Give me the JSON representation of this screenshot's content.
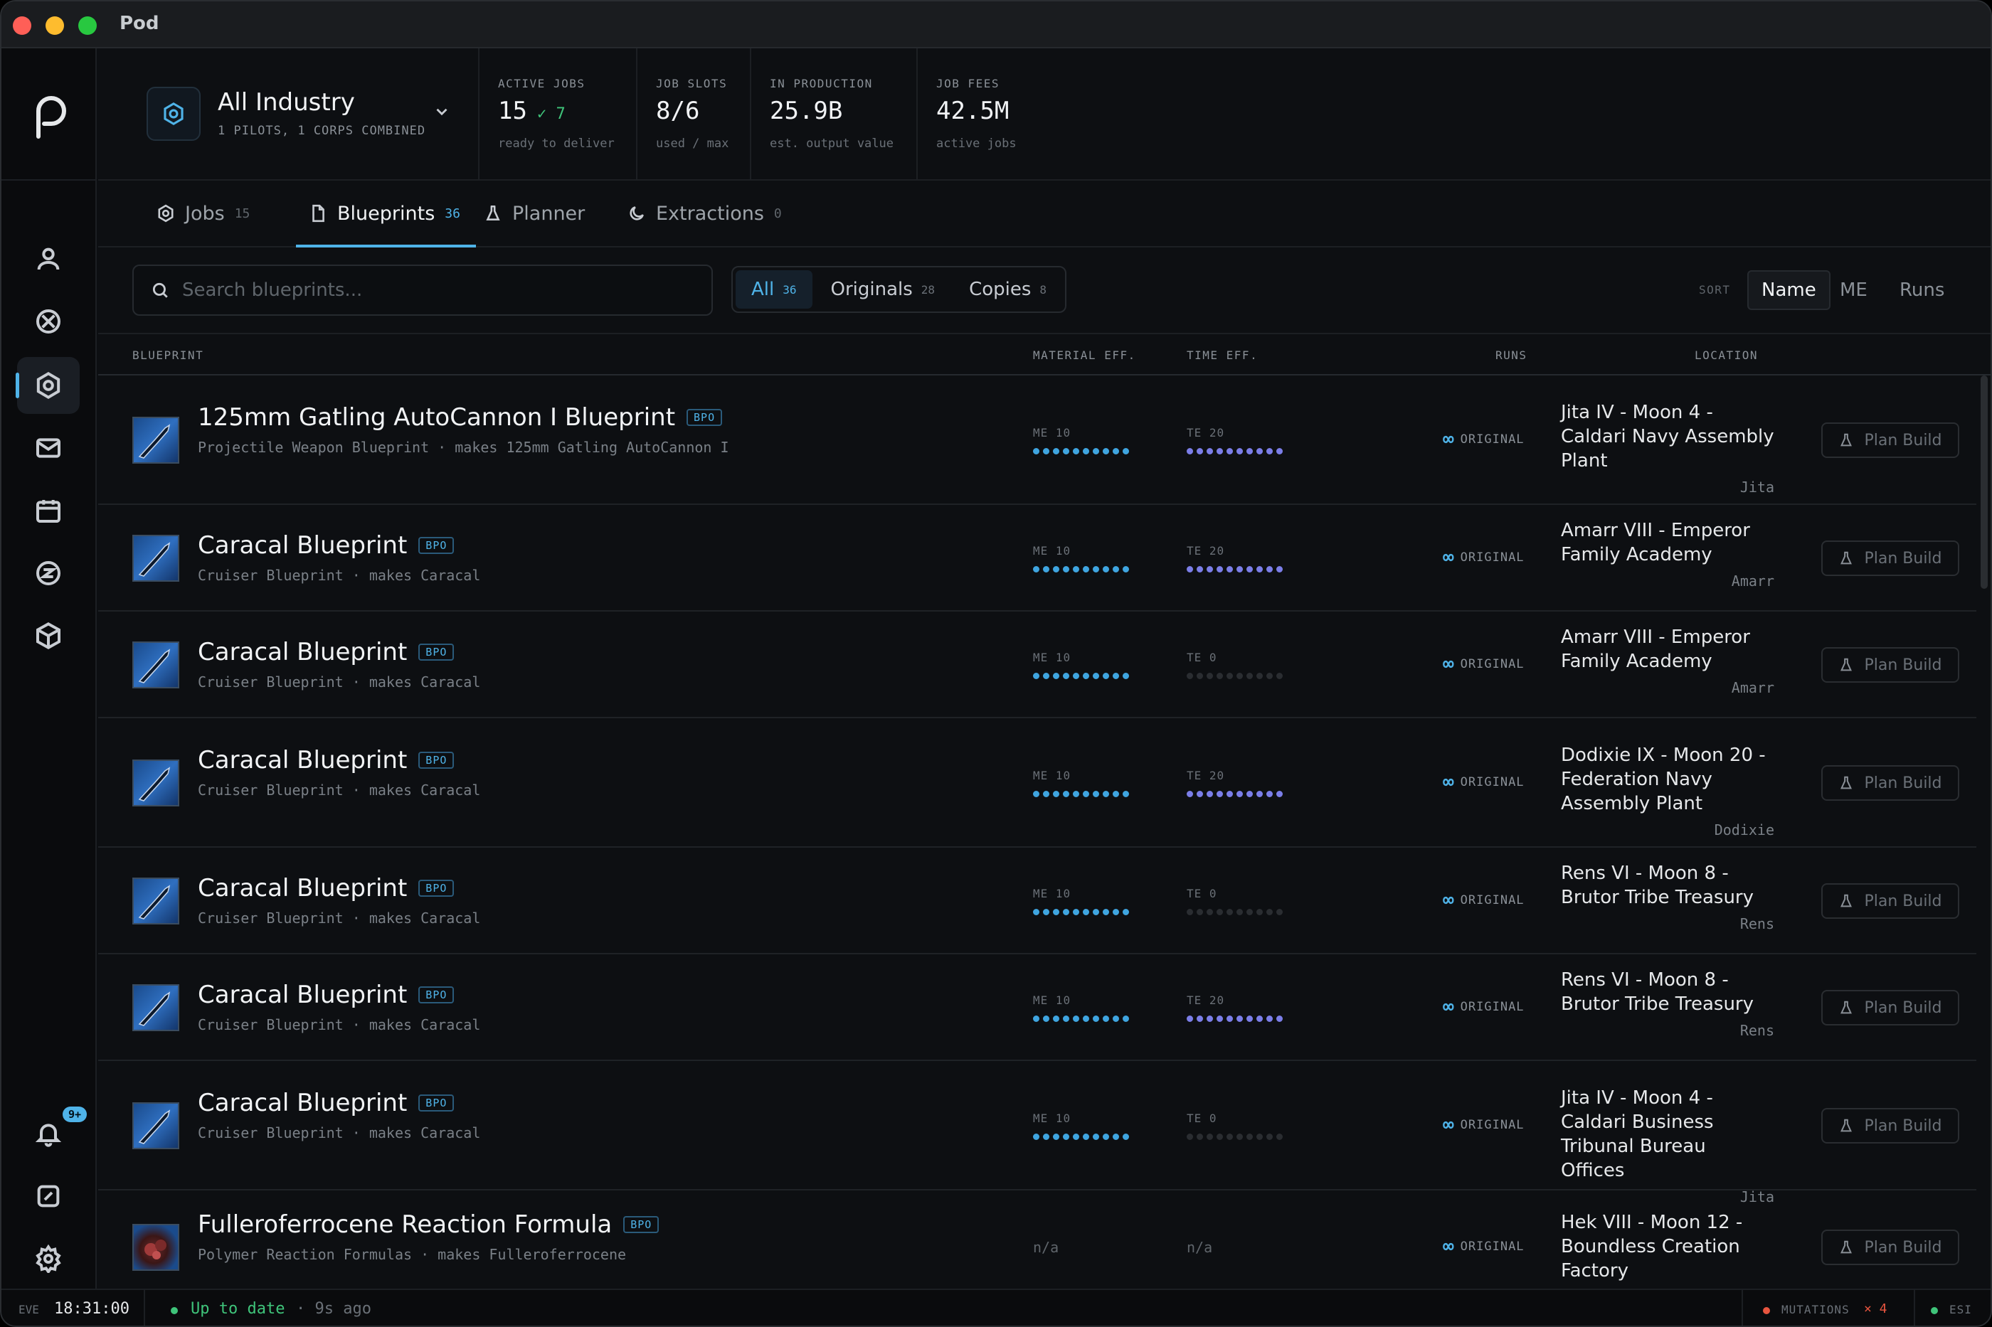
{
  "window": {
    "title": "Pod"
  },
  "header": {
    "title": "All Industry",
    "subtitle": "1 PILOTS, 1 CORPS COMBINED",
    "stats": [
      {
        "label": "ACTIVE JOBS",
        "value": "15",
        "extra": "✓ 7",
        "sub": "ready to deliver"
      },
      {
        "label": "JOB SLOTS",
        "value": "8/6",
        "sub": "used / max"
      },
      {
        "label": "IN PRODUCTION",
        "value": "25.9B",
        "sub": "est. output value"
      },
      {
        "label": "JOB FEES",
        "value": "42.5M",
        "sub": "active jobs"
      }
    ]
  },
  "tabs": [
    {
      "label": "Jobs",
      "count": "15",
      "icon": "jobs-icon"
    },
    {
      "label": "Blueprints",
      "count": "36",
      "icon": "blueprint-icon",
      "active": true
    },
    {
      "label": "Planner",
      "count": "",
      "icon": "flask-icon"
    },
    {
      "label": "Extractions",
      "count": "0",
      "icon": "moon-icon"
    }
  ],
  "search": {
    "placeholder": "Search blueprints..."
  },
  "filters": [
    {
      "label": "All",
      "count": "36",
      "active": true
    },
    {
      "label": "Originals",
      "count": "28"
    },
    {
      "label": "Copies",
      "count": "8"
    }
  ],
  "sort": {
    "label": "SORT",
    "options": [
      "Name",
      "ME",
      "Runs"
    ],
    "active": "Name"
  },
  "columns": {
    "blueprint": "BLUEPRINT",
    "me": "MATERIAL EFF.",
    "te": "TIME EFF.",
    "runs": "RUNS",
    "location": "LOCATION"
  },
  "rows": [
    {
      "name": "125mm Gatling AutoCannon I Blueprint",
      "badge": "BPO",
      "desc": "Projectile Weapon Blueprint · makes 125mm Gatling AutoCannon I",
      "me_label": "ME 10",
      "te_label": "TE 20",
      "me": 10,
      "te": 10,
      "runs": "ORIGINAL",
      "location": "Jita IV - Moon 4 - Caldari Navy Assembly Plant",
      "system": "Jita",
      "action": "Plan Build"
    },
    {
      "name": "Caracal Blueprint",
      "badge": "BPO",
      "desc": "Cruiser Blueprint · makes Caracal",
      "me_label": "ME 10",
      "te_label": "TE 20",
      "me": 10,
      "te": 10,
      "runs": "ORIGINAL",
      "location": "Amarr VIII - Emperor Family Academy",
      "system": "Amarr",
      "action": "Plan Build"
    },
    {
      "name": "Caracal Blueprint",
      "badge": "BPO",
      "desc": "Cruiser Blueprint · makes Caracal",
      "me_label": "ME 10",
      "te_label": "TE 0",
      "me": 10,
      "te": 0,
      "runs": "ORIGINAL",
      "location": "Amarr VIII - Emperor Family Academy",
      "system": "Amarr",
      "action": "Plan Build"
    },
    {
      "name": "Caracal Blueprint",
      "badge": "BPO",
      "desc": "Cruiser Blueprint · makes Caracal",
      "me_label": "ME 10",
      "te_label": "TE 20",
      "me": 10,
      "te": 10,
      "runs": "ORIGINAL",
      "location": "Dodixie IX - Moon 20 - Federation Navy Assembly Plant",
      "system": "Dodixie",
      "action": "Plan Build"
    },
    {
      "name": "Caracal Blueprint",
      "badge": "BPO",
      "desc": "Cruiser Blueprint · makes Caracal",
      "me_label": "ME 10",
      "te_label": "TE 0",
      "me": 10,
      "te": 0,
      "runs": "ORIGINAL",
      "location": "Rens VI - Moon 8 - Brutor Tribe Treasury",
      "system": "Rens",
      "action": "Plan Build"
    },
    {
      "name": "Caracal Blueprint",
      "badge": "BPO",
      "desc": "Cruiser Blueprint · makes Caracal",
      "me_label": "ME 10",
      "te_label": "TE 20",
      "me": 10,
      "te": 10,
      "runs": "ORIGINAL",
      "location": "Rens VI - Moon 8 - Brutor Tribe Treasury",
      "system": "Rens",
      "action": "Plan Build"
    },
    {
      "name": "Caracal Blueprint",
      "badge": "BPO",
      "desc": "Cruiser Blueprint · makes Caracal",
      "me_label": "ME 10",
      "te_label": "TE 0",
      "me": 10,
      "te": 0,
      "runs": "ORIGINAL",
      "location": "Jita IV - Moon 4 - Caldari Business Tribunal Bureau Offices",
      "system": "Jita",
      "action": "Plan Build"
    },
    {
      "name": "Fulleroferrocene Reaction Formula",
      "badge": "BPO",
      "desc": "Polymer Reaction Formulas · makes Fulleroferrocene",
      "me_label": "n/a",
      "te_label": "n/a",
      "me": null,
      "te": null,
      "runs": "ORIGINAL",
      "location": "Hek VIII - Moon 12 - Boundless Creation Factory",
      "system": "",
      "action": "Plan Build"
    }
  ],
  "statusbar": {
    "eve_label": "EVE",
    "time": "18:31:00",
    "status": "Up to date",
    "ago": "· 9s ago",
    "mutations_label": "MUTATIONS",
    "mutations_count": "× 4",
    "esi_label": "ESI"
  },
  "notifications": {
    "badge": "9+"
  },
  "colors": {
    "accent": "#4fb3e8",
    "me": "#3fa5e0",
    "te": "#7b7ee8",
    "ok": "#3fc47a",
    "error": "#e8553f"
  }
}
